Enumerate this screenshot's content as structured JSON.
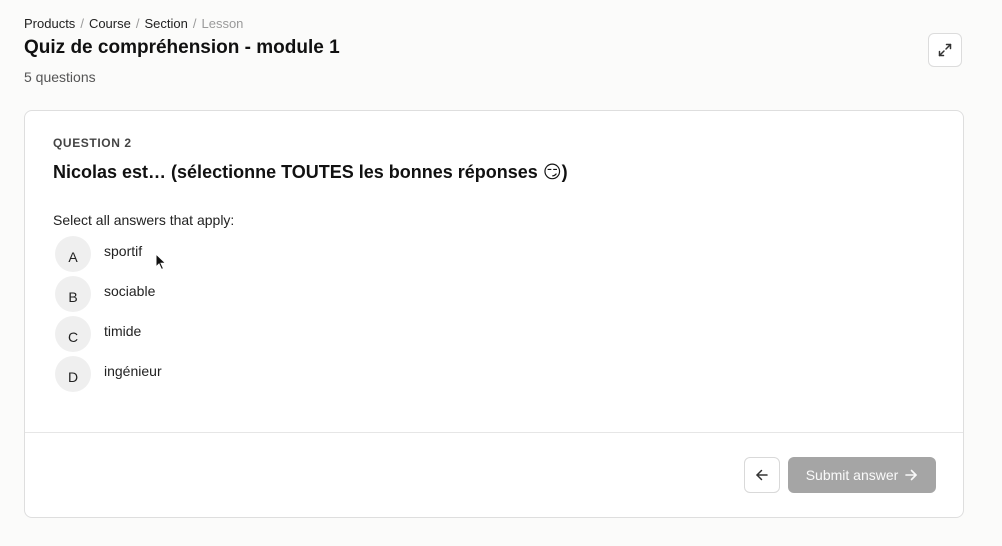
{
  "breadcrumb": {
    "items": [
      "Products",
      "Course",
      "Section"
    ],
    "current": "Lesson",
    "separator": "/"
  },
  "header": {
    "title": "Quiz de compréhension - module 1",
    "subtitle": "5 questions",
    "expand_icon": "expand-icon"
  },
  "question": {
    "label": "QUESTION 2",
    "text": "Nicolas est… (sélectionne TOUTES les bonnes réponses 😏)",
    "instructions": "Select all answers that apply:",
    "options": [
      {
        "letter": "A",
        "text": "sportif"
      },
      {
        "letter": "B",
        "text": "sociable"
      },
      {
        "letter": "C",
        "text": "timide"
      },
      {
        "letter": "D",
        "text": "ingénieur"
      }
    ]
  },
  "footer": {
    "back_icon": "arrow-left-icon",
    "submit_label": "Submit answer",
    "submit_icon": "arrow-right-icon"
  },
  "colors": {
    "submit_disabled_bg": "#a5a5a5",
    "option_circle_bg": "#efefef",
    "border": "#dedede"
  }
}
